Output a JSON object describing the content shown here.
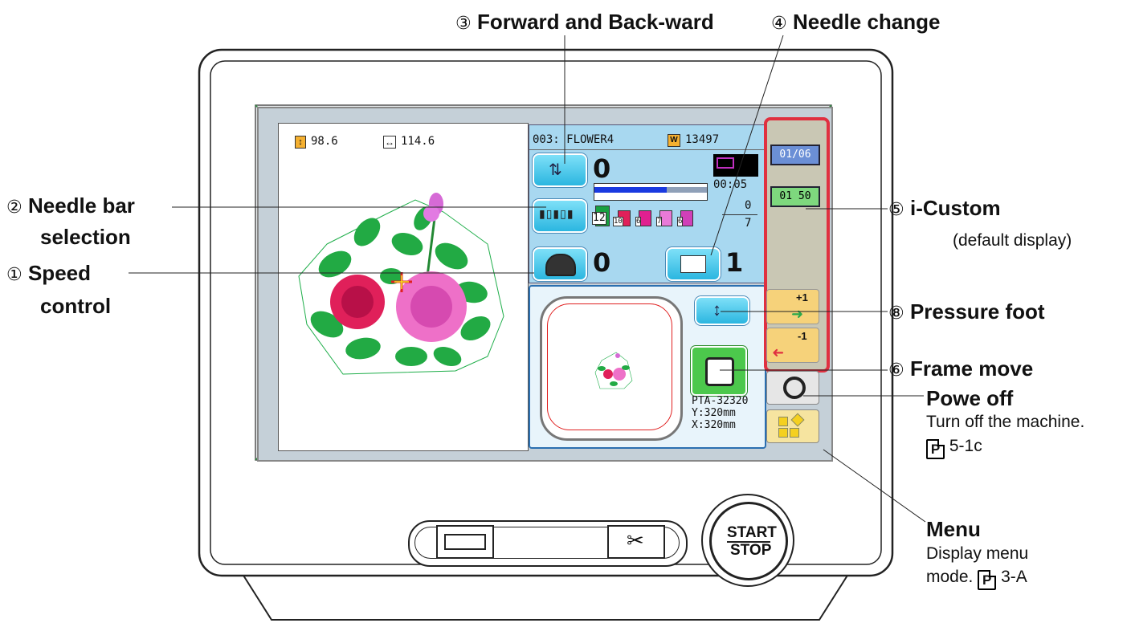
{
  "labels": {
    "forward_num": "③",
    "forward_text": "Forward and Back-ward",
    "needle_change_num": "④",
    "needle_change_text": "Needle change",
    "needle_bar_num": "②",
    "needle_bar_line1": "Needle bar",
    "needle_bar_line2": "selection",
    "speed_num": "①",
    "speed_line1": "Speed",
    "speed_line2": "control",
    "icustom_num": "⑤",
    "icustom_text": "i-Custom",
    "icustom_sub": "(default display)",
    "pressure_num": "⑧",
    "pressure_text": "Pressure foot",
    "frame_num": "⑥",
    "frame_text": "Frame move",
    "power_title": "Powe off",
    "power_desc": "Turn off the machine.",
    "power_ref": "5-1c",
    "menu_title": "Menu",
    "menu_desc1": "Display menu",
    "menu_desc2": "mode.",
    "menu_ref": "3-A",
    "p_icon": "P"
  },
  "screen": {
    "height_val": "98.6",
    "width_val": "114.6",
    "design_name": "003: FLOWER4",
    "stitch_count": "13497",
    "forward_value": "0",
    "time": "00:05",
    "needle_top": "0",
    "needle_bottom": "7",
    "speed_value": "0",
    "needle_number": "1",
    "needle_counts": [
      "12",
      "10",
      "6",
      "7",
      "6"
    ],
    "frame_model": "PTA-32320",
    "frame_y": "Y:320mm",
    "frame_x": "X:320mm",
    "custom_btn1": "01/06",
    "custom_btn2": "01 50",
    "pf_plus": "+1",
    "pf_minus": "-1"
  },
  "machine": {
    "start_label": "START",
    "stop_label": "STOP"
  },
  "icons": [
    "height-icon",
    "width-icon",
    "stitch-icon",
    "forward-back-icon",
    "needle-bar-icon",
    "speedometer-icon",
    "needle-change-icon",
    "pressure-foot-icon",
    "frame-move-icon",
    "power-icon",
    "menu-icon",
    "usb-icon",
    "scissors-icon"
  ],
  "colors": {
    "screen_blue": "#a8d8f0",
    "custom_border": "#e03040",
    "button_cyan": "#2bb6e0",
    "frame_green": "#4cc84c"
  }
}
